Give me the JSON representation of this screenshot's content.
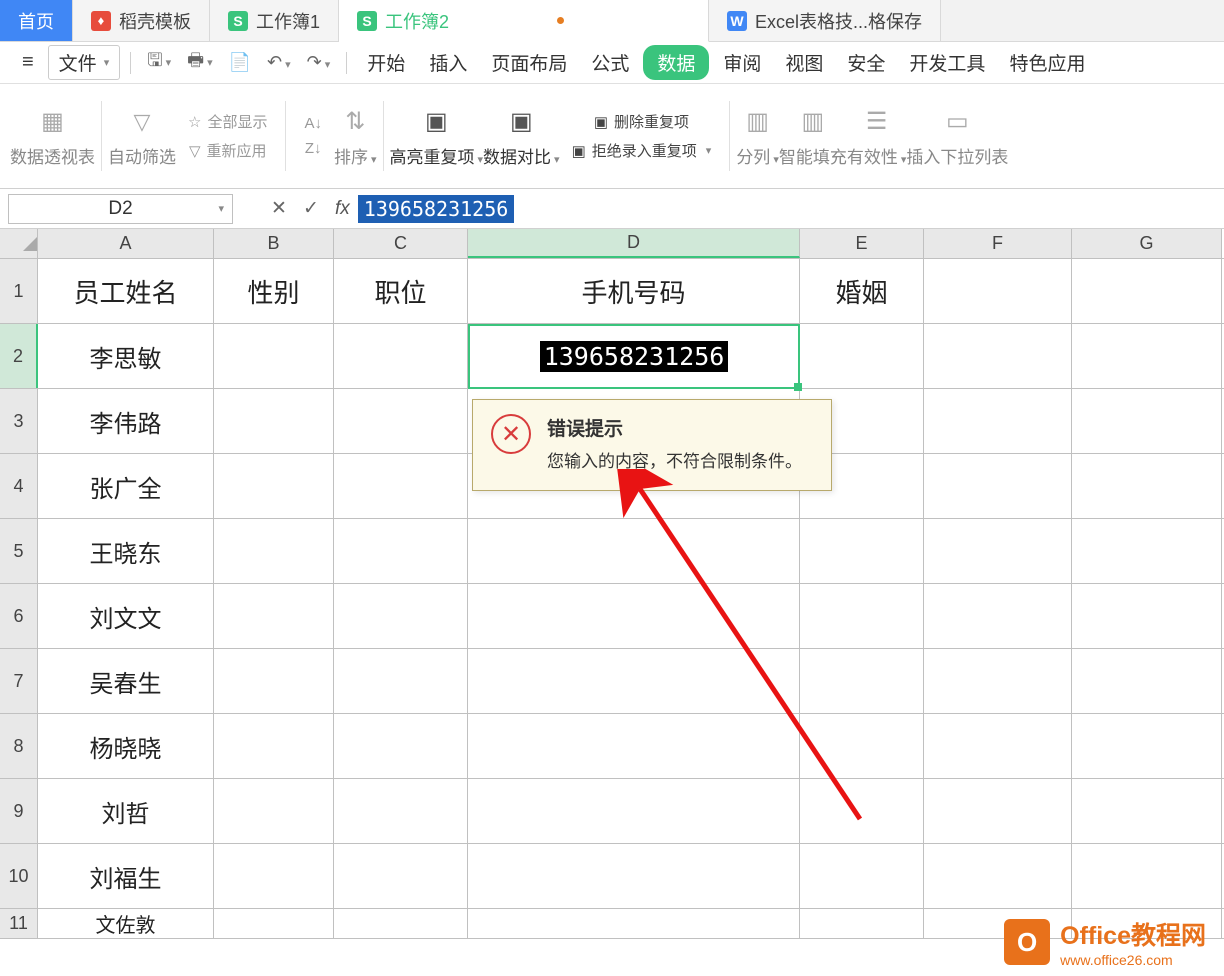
{
  "tabs": {
    "home": "首页",
    "template": "稻壳模板",
    "wb1": "工作簿1",
    "wb2": "工作簿2",
    "excel_tech": "Excel表格技...格保存"
  },
  "menu": {
    "file": "文件",
    "start": "开始",
    "insert": "插入",
    "page_layout": "页面布局",
    "formula": "公式",
    "data": "数据",
    "review": "审阅",
    "view": "视图",
    "security": "安全",
    "dev_tools": "开发工具",
    "special": "特色应用"
  },
  "ribbon": {
    "pivot": "数据透视表",
    "auto_filter": "自动筛选",
    "show_all": "全部显示",
    "reapply": "重新应用",
    "sort": "排序",
    "highlight_dup": "高亮重复项",
    "data_compare": "数据对比",
    "reject_dup": "拒绝录入重复项",
    "remove_dup": "删除重复项",
    "text_to_cols": "分列",
    "smart_fill": "智能填充",
    "validity": "有效性",
    "insert_dropdown": "插入下拉列表"
  },
  "formula_bar": {
    "cell_ref": "D2",
    "value": "139658231256"
  },
  "cols": [
    "A",
    "B",
    "C",
    "D",
    "E",
    "F",
    "G"
  ],
  "headers": {
    "A": "员工姓名",
    "B": "性别",
    "C": "职位",
    "D": "手机号码",
    "E": "婚姻"
  },
  "rows": [
    {
      "num": "1"
    },
    {
      "num": "2",
      "A": "李思敏"
    },
    {
      "num": "3",
      "A": "李伟路"
    },
    {
      "num": "4",
      "A": "张广全"
    },
    {
      "num": "5",
      "A": "王晓东"
    },
    {
      "num": "6",
      "A": "刘文文"
    },
    {
      "num": "7",
      "A": "吴春生"
    },
    {
      "num": "8",
      "A": "杨晓晓"
    },
    {
      "num": "9",
      "A": "刘哲"
    },
    {
      "num": "10",
      "A": "刘福生"
    },
    {
      "num": "11",
      "A": "文佐敦"
    }
  ],
  "active": {
    "value": "139658231256"
  },
  "error": {
    "title": "错误提示",
    "message": "您输入的内容，不符合限制条件。"
  },
  "watermark": {
    "title": "Office教程网",
    "url": "www.office26.com"
  }
}
